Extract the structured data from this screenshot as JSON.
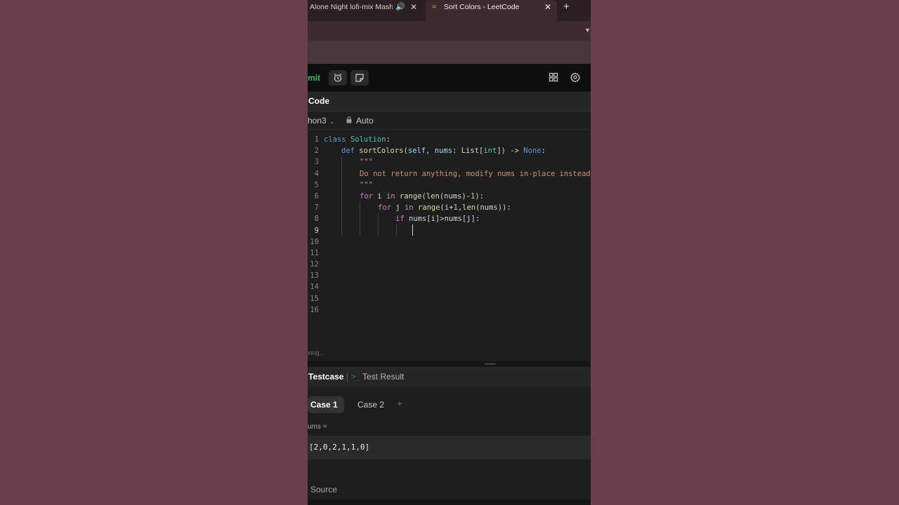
{
  "browser": {
    "tab1_title": "Alone Night lofi-mix Mash",
    "tab2_title": "Sort Colors - LeetCode",
    "icons": [
      "speaker-icon",
      "close-icon",
      "leetcode-favicon",
      "close-icon",
      "new-tab-icon"
    ]
  },
  "toolbar": {
    "submit_label": "mit",
    "submit_color": "#2cbb5d",
    "icons": [
      "alarm-clock-icon",
      "note-icon",
      "layout-icon",
      "gear-icon"
    ]
  },
  "code_panel": {
    "title": "Code",
    "language": "hon3",
    "auto_label": "Auto",
    "line_numbers": [
      "1",
      "2",
      "3",
      "4",
      "5",
      "6",
      "7",
      "8",
      "9",
      "10",
      "11",
      "12",
      "13",
      "14",
      "15",
      "16"
    ],
    "current_line": "9",
    "lines": {
      "l1": [
        "class",
        " ",
        "Solution",
        ":"
      ],
      "l2": [
        "def",
        " ",
        "sortColors",
        "(",
        "self",
        ", ",
        "nums",
        ": List[",
        "int",
        "]) -> ",
        "None",
        ":"
      ],
      "l3": "\"\"\"",
      "l4": "Do not return anything, modify nums in-place instead",
      "l5": "\"\"\"",
      "l6": [
        "for",
        " i ",
        "in",
        " ",
        "range",
        "(",
        "len",
        "(nums)-",
        "1",
        "):"
      ],
      "l7": [
        "for",
        " j ",
        "in",
        " ",
        "range",
        "(i+",
        "1",
        ",",
        "len",
        "(nums)):"
      ],
      "l8": [
        "if",
        " nums[i]>nums[j]:"
      ]
    },
    "status": "ving..."
  },
  "testcase": {
    "tab_label": "Testcase",
    "result_icon": ">_",
    "result_label": "Test Result",
    "cases": [
      "Case 1",
      "Case 2"
    ],
    "add_label": "+",
    "param_label": "ums =",
    "param_value": "[2,0,2,1,1,0]",
    "source_label": "Source"
  }
}
